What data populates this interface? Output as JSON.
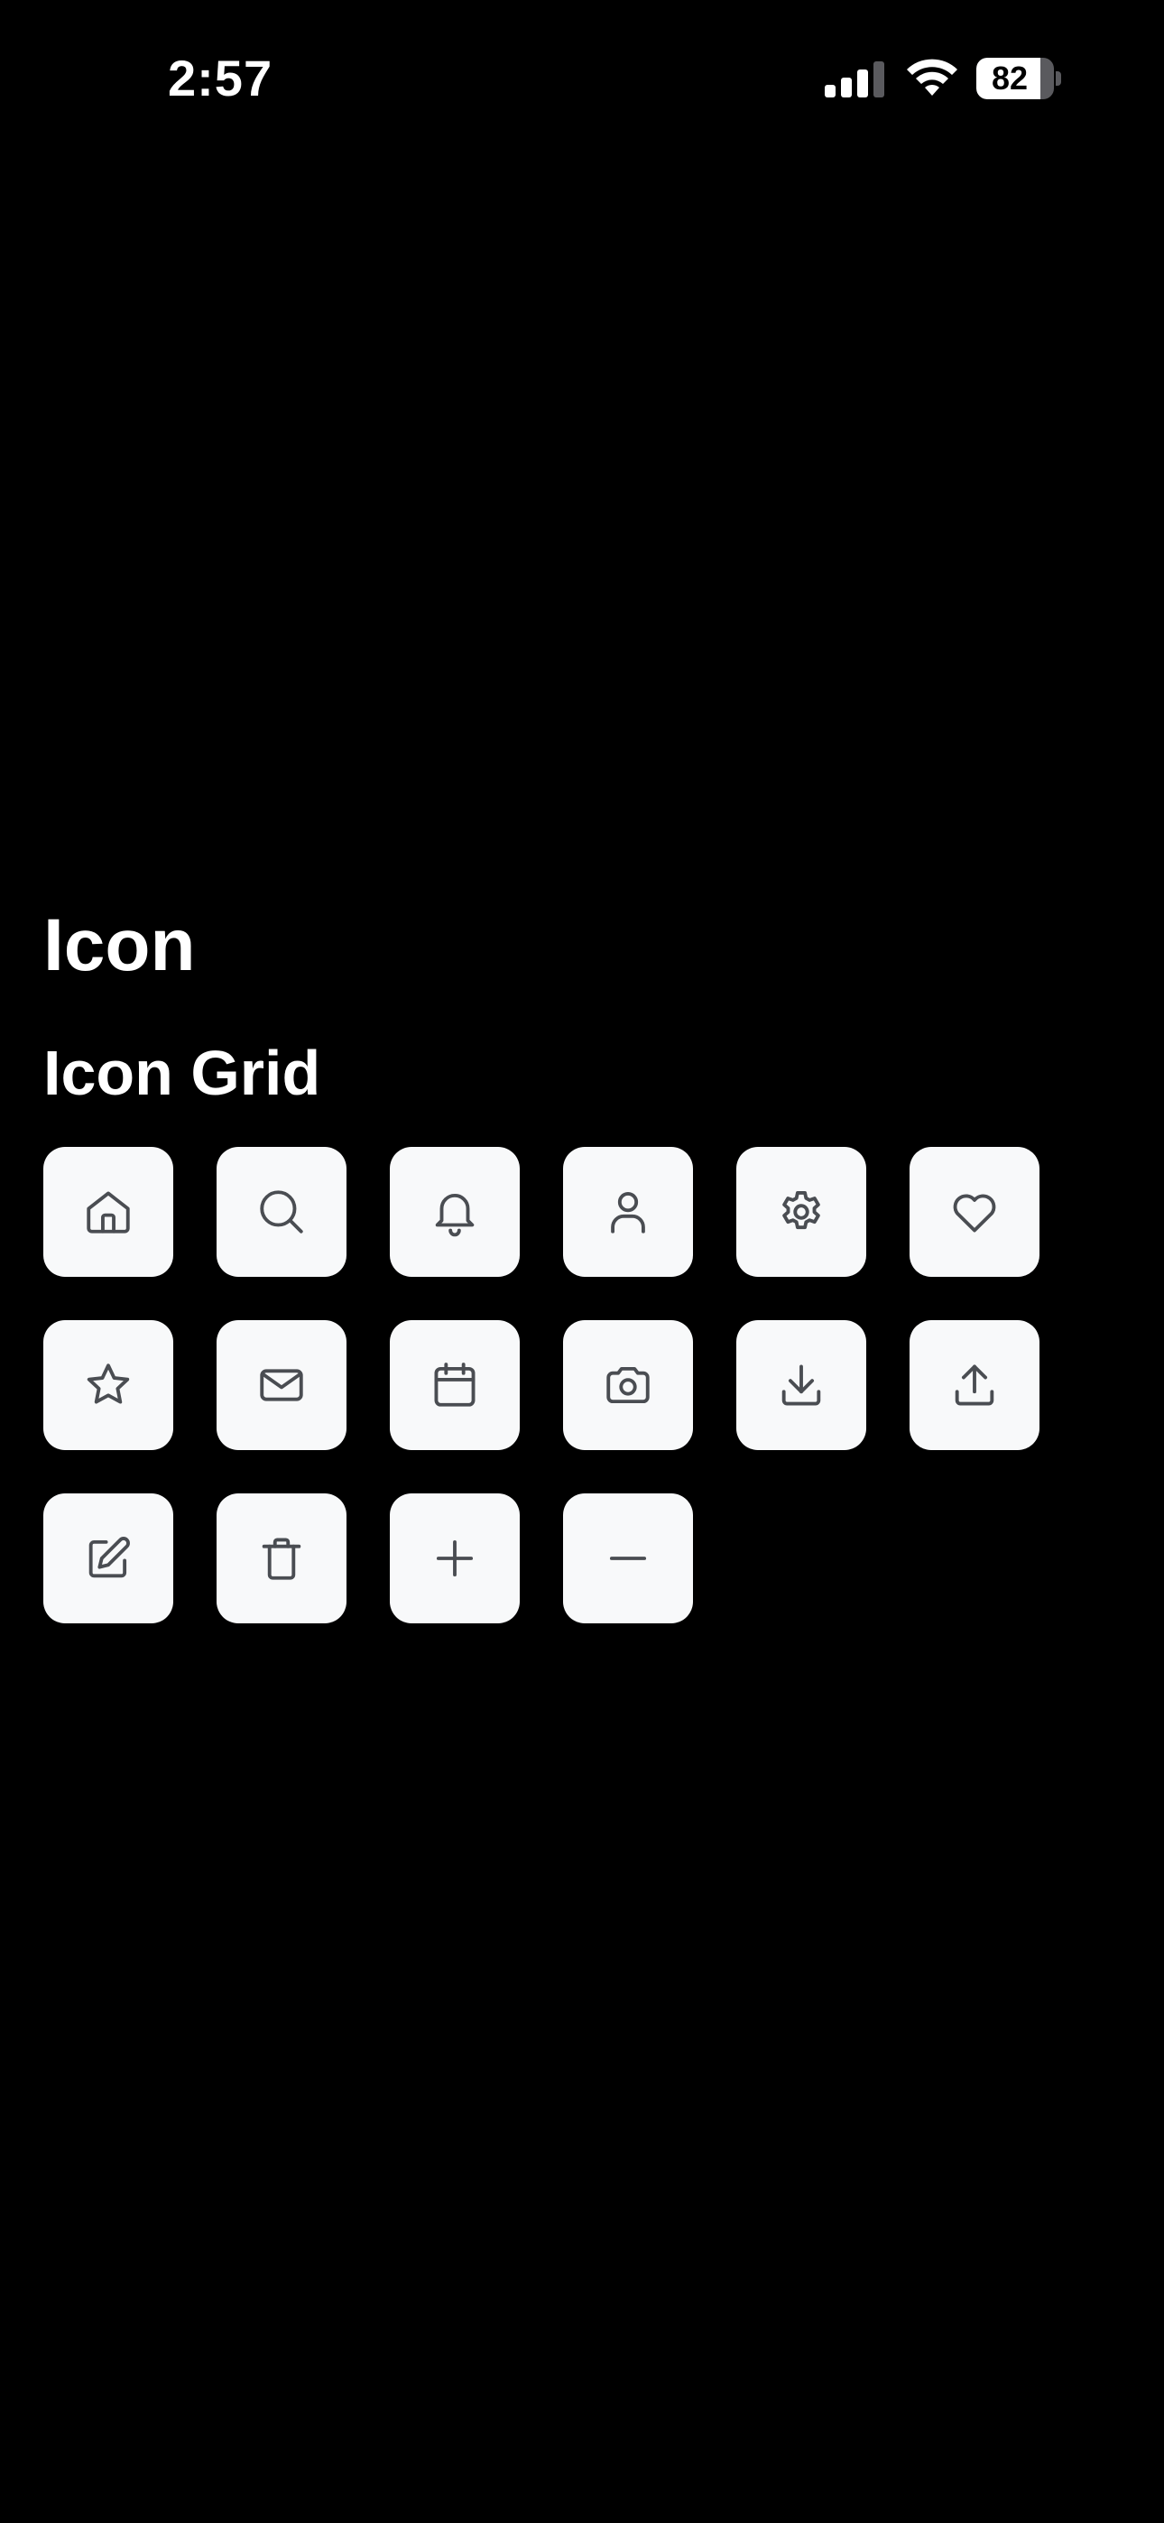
{
  "status_bar": {
    "time": "2:57",
    "battery_level": "82",
    "battery_fraction": 0.82,
    "signal_bars_active": 3,
    "signal_bars_total": 4
  },
  "page": {
    "title": "Icon",
    "section_title": "Icon Grid"
  },
  "icons": [
    {
      "name": "home-icon"
    },
    {
      "name": "search-icon"
    },
    {
      "name": "bell-icon"
    },
    {
      "name": "user-icon"
    },
    {
      "name": "gear-icon"
    },
    {
      "name": "heart-icon"
    },
    {
      "name": "star-icon"
    },
    {
      "name": "mail-icon"
    },
    {
      "name": "calendar-icon"
    },
    {
      "name": "camera-icon"
    },
    {
      "name": "download-icon"
    },
    {
      "name": "upload-icon"
    },
    {
      "name": "edit-icon"
    },
    {
      "name": "trash-icon"
    },
    {
      "name": "plus-icon"
    },
    {
      "name": "minus-icon"
    }
  ],
  "colors": {
    "background": "#000000",
    "tile": "#f8f9fa",
    "icon_stroke": "#4a4d52",
    "text": "#ffffff"
  }
}
